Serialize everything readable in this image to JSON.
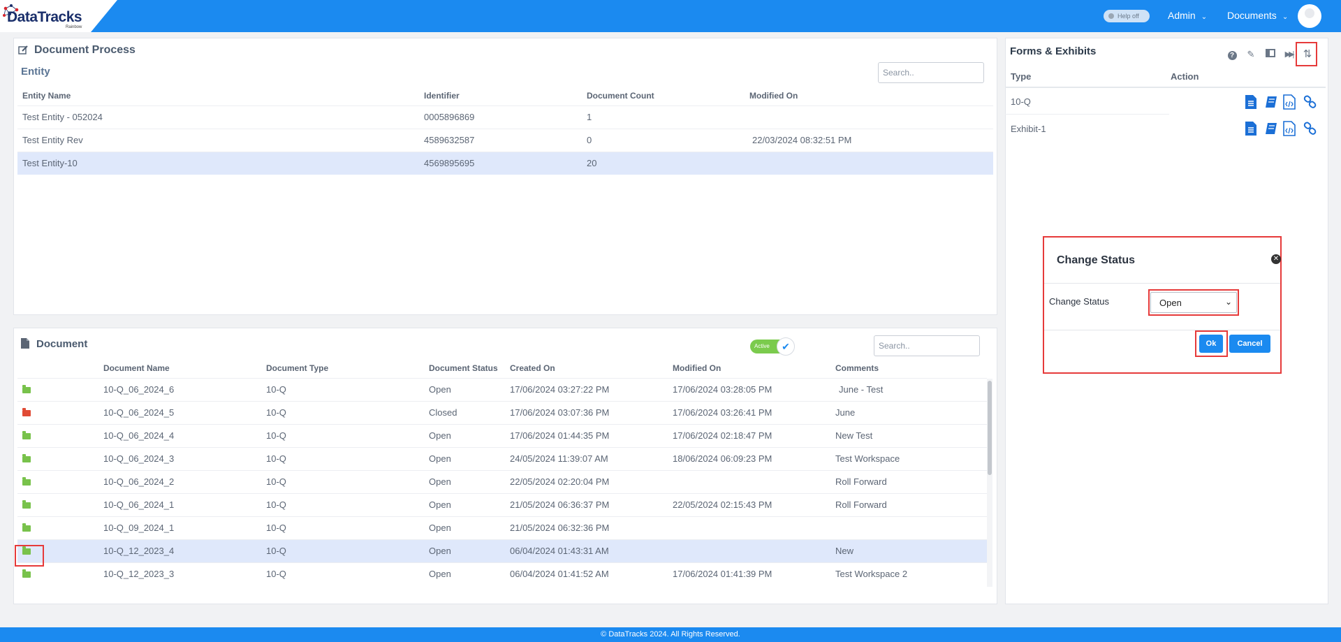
{
  "header": {
    "logo_text": "DataTracks",
    "logo_sub": "Rainbow",
    "help_toggle": "Help off",
    "nav": [
      {
        "label": "Admin"
      },
      {
        "label": "Documents"
      }
    ]
  },
  "document_process": {
    "title": "Document Process",
    "entity_title": "Entity",
    "search_placeholder": "Search..",
    "columns": [
      "Entity Name",
      "Identifier",
      "Document Count",
      "Modified On"
    ],
    "rows": [
      {
        "name": "Test Entity - 052024",
        "identifier": "0005896869",
        "count": "1",
        "modified": ""
      },
      {
        "name": "Test Entity Rev",
        "identifier": "4589632587",
        "count": "0",
        "modified": "22/03/2024 08:32:51 PM"
      },
      {
        "name": "Test Entity-10",
        "identifier": "4569895695",
        "count": "20",
        "modified": ""
      }
    ]
  },
  "document": {
    "title": "Document",
    "toggle_label": "Active",
    "search_placeholder": "Search..",
    "columns": [
      "Document Name",
      "Document Type",
      "Document Status",
      "Created On",
      "Modified On",
      "Comments"
    ],
    "rows": [
      {
        "name": "10-Q_06_2024_6",
        "type": "10-Q",
        "status": "Open",
        "created": "17/06/2024 03:27:22 PM",
        "modified": "17/06/2024 03:28:05 PM",
        "comments": "June - Test"
      },
      {
        "name": "10-Q_06_2024_5",
        "type": "10-Q",
        "status": "Closed",
        "created": "17/06/2024 03:07:36 PM",
        "modified": "17/06/2024 03:26:41 PM",
        "comments": "June"
      },
      {
        "name": "10-Q_06_2024_4",
        "type": "10-Q",
        "status": "Open",
        "created": "17/06/2024 01:44:35 PM",
        "modified": "17/06/2024 02:18:47 PM",
        "comments": "New Test"
      },
      {
        "name": "10-Q_06_2024_3",
        "type": "10-Q",
        "status": "Open",
        "created": "24/05/2024 11:39:07 AM",
        "modified": "18/06/2024 06:09:23 PM",
        "comments": "Test Workspace"
      },
      {
        "name": "10-Q_06_2024_2",
        "type": "10-Q",
        "status": "Open",
        "created": "22/05/2024 02:20:04 PM",
        "modified": "",
        "comments": "Roll Forward"
      },
      {
        "name": "10-Q_06_2024_1",
        "type": "10-Q",
        "status": "Open",
        "created": "21/05/2024 06:36:37 PM",
        "modified": "22/05/2024 02:15:43 PM",
        "comments": "Roll Forward"
      },
      {
        "name": "10-Q_09_2024_1",
        "type": "10-Q",
        "status": "Open",
        "created": "21/05/2024 06:32:36 PM",
        "modified": "",
        "comments": ""
      },
      {
        "name": "10-Q_12_2023_4",
        "type": "10-Q",
        "status": "Open",
        "created": "06/04/2024 01:43:31 AM",
        "modified": "",
        "comments": "New"
      },
      {
        "name": "10-Q_12_2023_3",
        "type": "10-Q",
        "status": "Open",
        "created": "06/04/2024 01:41:52 AM",
        "modified": "17/06/2024 01:41:39 PM",
        "comments": "Test Workspace 2"
      }
    ]
  },
  "forms": {
    "title": "Forms & Exhibits",
    "columns": [
      "Type",
      "Action"
    ],
    "rows": [
      {
        "type": "10-Q"
      },
      {
        "type": "Exhibit-1"
      }
    ]
  },
  "modal": {
    "title": "Change Status",
    "label": "Change Status",
    "selected": "Open",
    "ok": "Ok",
    "cancel": "Cancel"
  },
  "footer": {
    "text": "© DataTracks 2024. All Rights Reserved."
  },
  "colors": {
    "primary": "#1b8af0",
    "highlight": "#e63a3a",
    "folder_open": "#78c24b",
    "folder_closed": "#e04b35"
  }
}
